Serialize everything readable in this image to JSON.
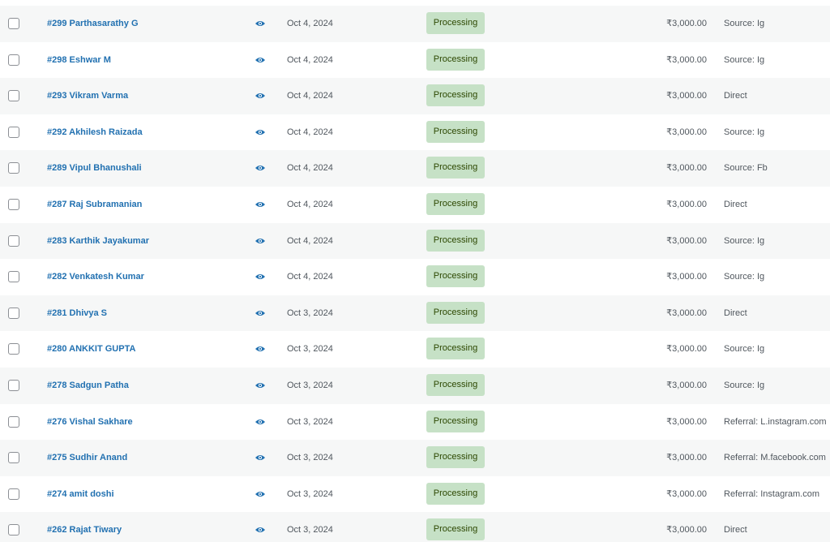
{
  "colors": {
    "link": "#2271b1",
    "status_processing_bg": "#c6e1c6",
    "status_processing_text": "#2c4700",
    "row_alt_bg": "#f6f7f7"
  },
  "preview_icon": "eye-icon",
  "orders": [
    {
      "label": "#299 Parthasarathy G",
      "date": "Oct 4, 2024",
      "status": "Processing",
      "total": "₹3,000.00",
      "origin": "Source: Ig"
    },
    {
      "label": "#298 Eshwar M",
      "date": "Oct 4, 2024",
      "status": "Processing",
      "total": "₹3,000.00",
      "origin": "Source: Ig"
    },
    {
      "label": "#293 Vikram Varma",
      "date": "Oct 4, 2024",
      "status": "Processing",
      "total": "₹3,000.00",
      "origin": "Direct"
    },
    {
      "label": "#292 Akhilesh Raizada",
      "date": "Oct 4, 2024",
      "status": "Processing",
      "total": "₹3,000.00",
      "origin": "Source: Ig"
    },
    {
      "label": "#289 Vipul Bhanushali",
      "date": "Oct 4, 2024",
      "status": "Processing",
      "total": "₹3,000.00",
      "origin": "Source: Fb"
    },
    {
      "label": "#287 Raj Subramanian",
      "date": "Oct 4, 2024",
      "status": "Processing",
      "total": "₹3,000.00",
      "origin": "Direct"
    },
    {
      "label": "#283 Karthik Jayakumar",
      "date": "Oct 4, 2024",
      "status": "Processing",
      "total": "₹3,000.00",
      "origin": "Source: Ig"
    },
    {
      "label": "#282 Venkatesh Kumar",
      "date": "Oct 4, 2024",
      "status": "Processing",
      "total": "₹3,000.00",
      "origin": "Source: Ig"
    },
    {
      "label": "#281 Dhivya S",
      "date": "Oct 3, 2024",
      "status": "Processing",
      "total": "₹3,000.00",
      "origin": "Direct"
    },
    {
      "label": "#280 ANKKIT GUPTA",
      "date": "Oct 3, 2024",
      "status": "Processing",
      "total": "₹3,000.00",
      "origin": "Source: Ig"
    },
    {
      "label": "#278 Sadgun Patha",
      "date": "Oct 3, 2024",
      "status": "Processing",
      "total": "₹3,000.00",
      "origin": "Source: Ig"
    },
    {
      "label": "#276 Vishal Sakhare",
      "date": "Oct 3, 2024",
      "status": "Processing",
      "total": "₹3,000.00",
      "origin": "Referral: L.instagram.com"
    },
    {
      "label": "#275 Sudhir Anand",
      "date": "Oct 3, 2024",
      "status": "Processing",
      "total": "₹3,000.00",
      "origin": "Referral: M.facebook.com"
    },
    {
      "label": "#274 amit doshi",
      "date": "Oct 3, 2024",
      "status": "Processing",
      "total": "₹3,000.00",
      "origin": "Referral: Instagram.com"
    },
    {
      "label": "#262 Rajat Tiwary",
      "date": "Oct 3, 2024",
      "status": "Processing",
      "total": "₹3,000.00",
      "origin": "Direct"
    }
  ]
}
